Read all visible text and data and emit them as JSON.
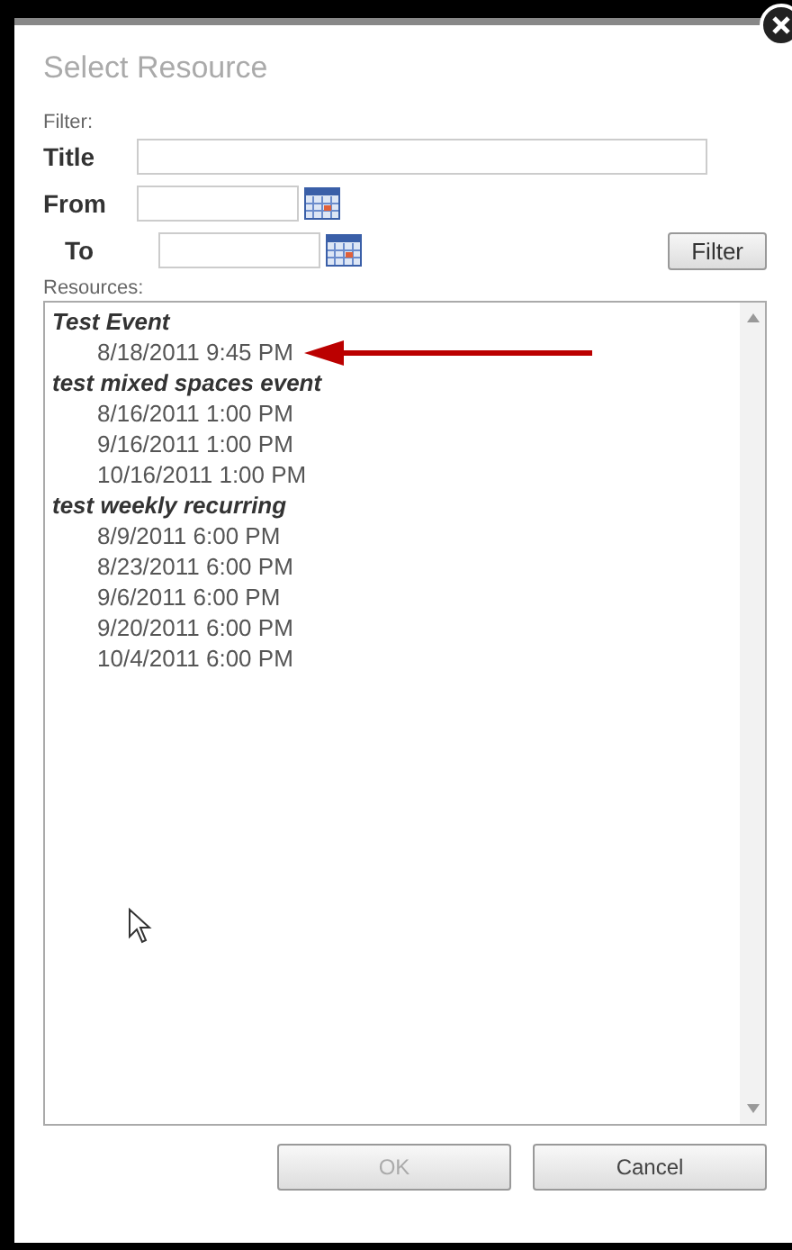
{
  "dialog": {
    "title": "Select Resource",
    "closable": true
  },
  "filter": {
    "heading": "Filter:",
    "fields": [
      {
        "label": "Title",
        "kind": "text"
      },
      {
        "label": "From",
        "kind": "date"
      },
      {
        "label": "To",
        "kind": "date"
      }
    ],
    "button": "Filter"
  },
  "resources": {
    "heading": "Resources:",
    "items": [
      {
        "label": "Test Event",
        "children": [
          {
            "label": "8/18/2011 9:45 PM",
            "annotated": true
          }
        ]
      },
      {
        "label": "test mixed spaces event",
        "children": [
          {
            "label": "8/16/2011 1:00 PM",
            "annotated": false
          },
          {
            "label": "9/16/2011 1:00 PM",
            "annotated": false
          },
          {
            "label": "10/16/2011 1:00 PM",
            "annotated": false
          }
        ]
      },
      {
        "label": "test weekly recurring",
        "children": [
          {
            "label": "8/9/2011 6:00 PM",
            "annotated": false
          },
          {
            "label": "8/23/2011 6:00 PM",
            "annotated": false
          },
          {
            "label": "9/6/2011 6:00 PM",
            "annotated": false
          },
          {
            "label": "9/20/2011 6:00 PM",
            "annotated": false
          },
          {
            "label": "10/4/2011 6:00 PM",
            "annotated": false
          }
        ]
      }
    ]
  },
  "buttons": [
    {
      "label": "OK",
      "disabled": true
    },
    {
      "label": "Cancel",
      "disabled": false
    }
  ]
}
